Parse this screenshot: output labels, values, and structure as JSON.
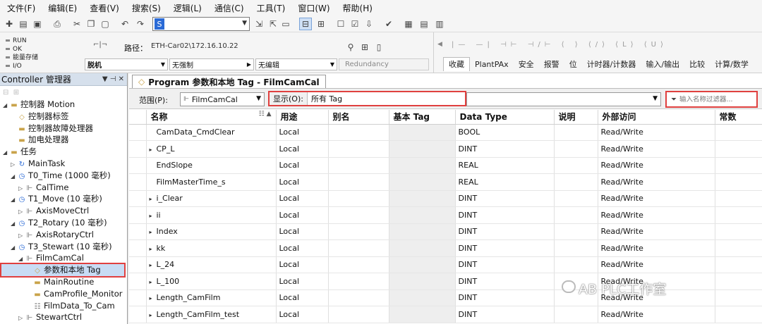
{
  "menu": [
    "文件(F)",
    "编辑(E)",
    "查看(V)",
    "搜索(S)",
    "逻辑(L)",
    "通信(C)",
    "工具(T)",
    "窗口(W)",
    "帮助(H)"
  ],
  "toolbar": {
    "search_value": "S"
  },
  "status": {
    "items": [
      "RUN",
      "OK",
      "能量存储",
      "I/O"
    ],
    "path_label": "路径：",
    "path_value": "ETH-Car02\\172.16.10.22",
    "mode": "脱机",
    "forces": "无强制",
    "edits": "无编辑",
    "redundancy": "Redundancy"
  },
  "instruction_tabs": [
    "收藏",
    "PlantPAx",
    "安全",
    "报警",
    "位",
    "计时器/计数器",
    "输入/输出",
    "比较",
    "计算/数学"
  ],
  "left_panel": {
    "title": "Controller 管理器",
    "tree": [
      {
        "label": "控制器 Motion",
        "icon": "folder-icon",
        "indent": 0,
        "twisty": "◢"
      },
      {
        "label": "控制器标签",
        "icon": "tag-icon",
        "indent": 1,
        "twisty": ""
      },
      {
        "label": "控制器故障处理器",
        "icon": "folder-icon",
        "indent": 1,
        "twisty": ""
      },
      {
        "label": "加电处理器",
        "icon": "folder-icon",
        "indent": 1,
        "twisty": ""
      },
      {
        "label": "任务",
        "icon": "folder-icon",
        "indent": 0,
        "twisty": "◢"
      },
      {
        "label": "MainTask",
        "icon": "task-icon",
        "indent": 1,
        "twisty": "▷"
      },
      {
        "label": "T0_Time (1000 毫秒)",
        "icon": "clock-icon",
        "indent": 1,
        "twisty": "◢"
      },
      {
        "label": "CalTime",
        "icon": "program-icon",
        "indent": 2,
        "twisty": "▷"
      },
      {
        "label": "T1_Move (10 毫秒)",
        "icon": "clock-icon",
        "indent": 1,
        "twisty": "◢"
      },
      {
        "label": "AxisMoveCtrl",
        "icon": "program-icon",
        "indent": 2,
        "twisty": "▷"
      },
      {
        "label": "T2_Rotary (10 毫秒)",
        "icon": "clock-icon",
        "indent": 1,
        "twisty": "◢"
      },
      {
        "label": "AxisRotaryCtrl",
        "icon": "program-icon",
        "indent": 2,
        "twisty": "▷"
      },
      {
        "label": "T3_Stewart (10 毫秒)",
        "icon": "clock-icon",
        "indent": 1,
        "twisty": "◢"
      },
      {
        "label": "FilmCamCal",
        "icon": "program-icon",
        "indent": 2,
        "twisty": "◢"
      },
      {
        "label": "参数和本地 Tag",
        "icon": "tag-icon",
        "indent": 3,
        "twisty": "",
        "selected": true
      },
      {
        "label": "MainRoutine",
        "icon": "folder-icon",
        "indent": 3,
        "twisty": ""
      },
      {
        "label": "CamProfile_Monitor",
        "icon": "folder-icon",
        "indent": 3,
        "twisty": ""
      },
      {
        "label": "FilmData_To_Cam",
        "icon": "routine-icon",
        "indent": 3,
        "twisty": ""
      },
      {
        "label": "StewartCtrl",
        "icon": "program-icon",
        "indent": 2,
        "twisty": "▷"
      }
    ]
  },
  "document": {
    "tab_title": "Program 参数和本地 Tag - FilmCamCal",
    "scope_label": "范围(P):",
    "scope_value": "FilmCamCal",
    "show_label": "显示(O):",
    "show_value": "所有 Tag",
    "filter_placeholder": "输入名称过滤器..."
  },
  "grid": {
    "columns": [
      "名称",
      "用途",
      "别名",
      "基本 Tag",
      "Data Type",
      "说明",
      "外部访问",
      "常数"
    ],
    "rows": [
      {
        "expand": false,
        "name": "CamData_CmdClear",
        "usage": "Local",
        "type": "BOOL",
        "access": "Read/Write"
      },
      {
        "expand": true,
        "name": "CP_L",
        "usage": "Local",
        "type": "DINT",
        "access": "Read/Write"
      },
      {
        "expand": false,
        "name": "EndSlope",
        "usage": "Local",
        "type": "REAL",
        "access": "Read/Write"
      },
      {
        "expand": false,
        "name": "FilmMasterTime_s",
        "usage": "Local",
        "type": "REAL",
        "access": "Read/Write"
      },
      {
        "expand": true,
        "name": "i_Clear",
        "usage": "Local",
        "type": "DINT",
        "access": "Read/Write"
      },
      {
        "expand": true,
        "name": "ii",
        "usage": "Local",
        "type": "DINT",
        "access": "Read/Write"
      },
      {
        "expand": true,
        "name": "Index",
        "usage": "Local",
        "type": "DINT",
        "access": "Read/Write"
      },
      {
        "expand": true,
        "name": "kk",
        "usage": "Local",
        "type": "DINT",
        "access": "Read/Write"
      },
      {
        "expand": true,
        "name": "L_24",
        "usage": "Local",
        "type": "DINT",
        "access": "Read/Write"
      },
      {
        "expand": true,
        "name": "L_100",
        "usage": "Local",
        "type": "DINT",
        "access": "Read/Write"
      },
      {
        "expand": true,
        "name": "Length_CamFilm",
        "usage": "Local",
        "type": "DINT",
        "access": "Read/Write"
      },
      {
        "expand": true,
        "name": "Length_CamFilm_test",
        "usage": "Local",
        "type": "DINT",
        "access": "Read/Write"
      }
    ]
  },
  "watermark": "AB PLC工作室"
}
